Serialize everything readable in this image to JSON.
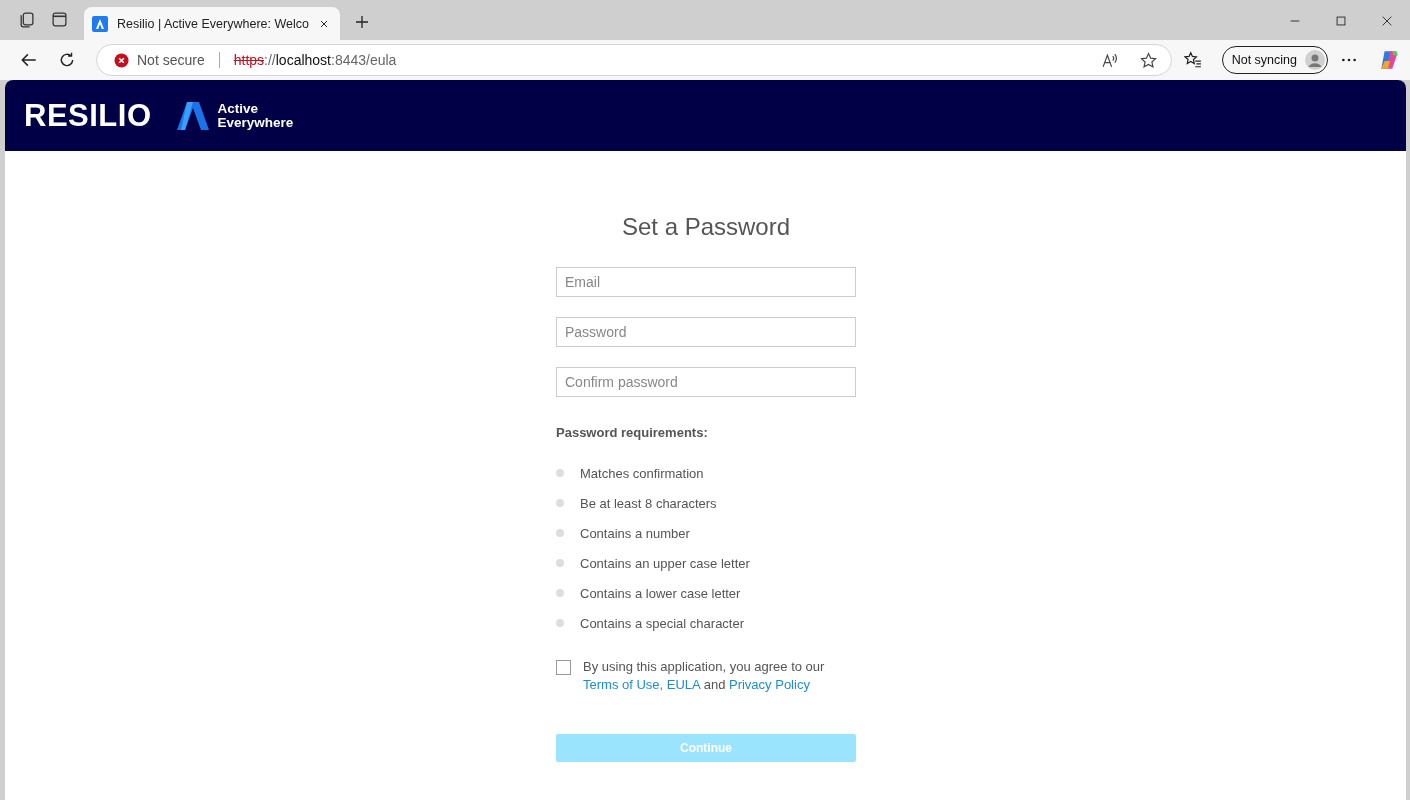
{
  "browser": {
    "tab": {
      "title": "Resilio | Active Everywhere: Welco",
      "selected": true
    },
    "address": {
      "security": "Not secure",
      "scheme": "https",
      "separator": "://",
      "host": "localhost",
      "rest": ":8443/eula"
    },
    "profile": "Not syncing"
  },
  "header": {
    "brand": "RESILIO",
    "product_line1": "Active",
    "product_line2": "Everywhere"
  },
  "form": {
    "title": "Set a Password",
    "fields": [
      {
        "placeholder": "Email"
      },
      {
        "placeholder": "Password"
      },
      {
        "placeholder": "Confirm password"
      }
    ],
    "requirements_title": "Password requirements:",
    "requirements": [
      {
        "label": "Matches confirmation",
        "met": false
      },
      {
        "label": "Be at least 8 characters",
        "met": false
      },
      {
        "label": "Contains a number",
        "met": false
      },
      {
        "label": "Contains an upper case letter",
        "met": false
      },
      {
        "label": "Contains a lower case letter",
        "met": false
      },
      {
        "label": "Contains a special character",
        "met": false
      }
    ],
    "agreement": {
      "checked": false,
      "prefix": "By using this application, you agree to our",
      "terms_link": "Terms of Use,",
      "eula_link": "EULA",
      "joiner": "and",
      "privacy_link": "Privacy Policy"
    },
    "continue": {
      "label": "Continue",
      "disabled": true
    }
  }
}
